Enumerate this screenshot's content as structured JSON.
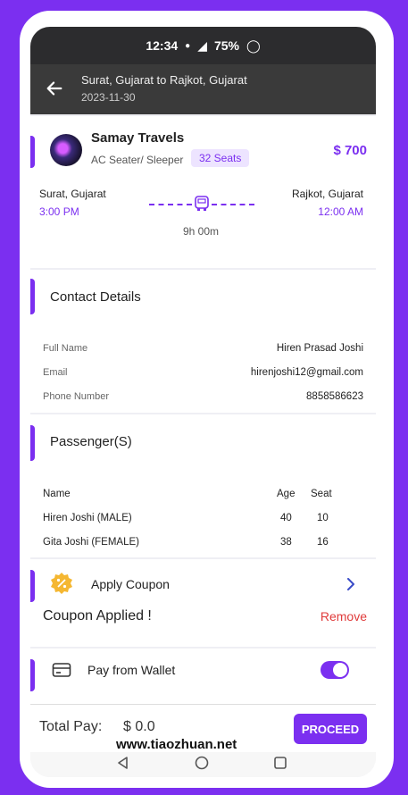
{
  "status_bar": {
    "time": "12:34",
    "battery": "75%"
  },
  "header": {
    "route": "Surat, Gujarat  to  Rajkot, Gujarat",
    "date": "2023-11-30"
  },
  "bus": {
    "operator": "Samay Travels",
    "type": "AC Seater/ Sleeper",
    "seats": "32 Seats",
    "price": "$ 700",
    "from_city": "Surat, Gujarat",
    "from_time": "3:00 PM",
    "to_city": "Rajkot, Gujarat",
    "to_time": "12:00 AM",
    "duration": "9h 00m"
  },
  "contact": {
    "title": "Contact Details",
    "rows": [
      {
        "label": "Full Name",
        "value": "Hiren Prasad Joshi"
      },
      {
        "label": "Email",
        "value": "hirenjoshi12@gmail.com"
      },
      {
        "label": "Phone Number",
        "value": "8858586623"
      }
    ]
  },
  "passengers": {
    "title": "Passenger(S)",
    "headers": {
      "name": "Name",
      "age": "Age",
      "seat": "Seat"
    },
    "rows": [
      {
        "name": "Hiren Joshi (MALE)",
        "age": "40",
        "seat": "10"
      },
      {
        "name": "Gita Joshi  (FEMALE)",
        "age": "38",
        "seat": "16"
      }
    ]
  },
  "coupon": {
    "label": "Apply Coupon",
    "applied": "Coupon Applied !",
    "remove": "Remove"
  },
  "wallet": {
    "label": "Pay from Wallet",
    "enabled": true
  },
  "footer": {
    "total_label": "Total Pay:",
    "total_amount": "$ 0.0",
    "proceed": "PROCEED",
    "watermark": "www.tiaozhuan.net"
  },
  "colors": {
    "accent": "#7B2FF0",
    "remove": "#e03b3b",
    "coupon": "#f5b731"
  },
  "icons": [
    "back-arrow-icon",
    "bus-icon",
    "coupon-badge-icon",
    "chevron-right-icon",
    "wallet-icon",
    "nav-back-icon",
    "nav-home-icon",
    "nav-recent-icon"
  ]
}
